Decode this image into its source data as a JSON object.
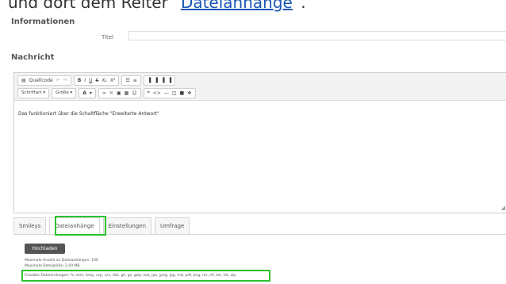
{
  "caption": {
    "prefix": "und dort dem Reiter “",
    "link": "Dateianhänge",
    "suffix": "”."
  },
  "sections": {
    "informationen": "Informationen",
    "nachricht": "Nachricht"
  },
  "titel": {
    "label": "Titel",
    "value": ""
  },
  "toolbar": {
    "row1": {
      "quellcode": "Quellcode",
      "undo": "↶",
      "redo": "↷",
      "bold": "B",
      "italic": "I",
      "underline": "U",
      "strike": "S",
      "subscript": "X₂",
      "superscript": "X²",
      "numbered_list": "☰",
      "bullet_list": "≡",
      "align_left": "▐",
      "align_center": "▐",
      "align_right": "▐",
      "align_justify": "▐"
    },
    "row2": {
      "schriftart": "Schriftart",
      "groesse": "Größe",
      "font_color": "A",
      "link": "∞",
      "unlink": "✖",
      "image": "▣",
      "table": "▦",
      "smiley": "☺",
      "quote": "❝",
      "code": "<>",
      "hr": "—",
      "media": "◫",
      "spoiler": "■",
      "other": "❖"
    }
  },
  "editor": {
    "content": "Das funktioniert über die Schaltfläche \"Erweiterte Antwort\""
  },
  "tabs": [
    {
      "label": "Smileys"
    },
    {
      "label": "Dateianhänge"
    },
    {
      "label": "Einstellungen"
    },
    {
      "label": "Umfrage"
    }
  ],
  "upload": {
    "button": "Hochladen",
    "max_count": "Maximale Anzahl an Dateianhängen: 100",
    "max_size": "Maximale Dateigröße: 2,00 MB",
    "extensions": "Erlaubte Dateiendungen: fs, sem, bmp, csp, csv, dat, gif, gs, gzip, bat, jpe, jpeg, jpg, md, pdf, png, rar, rtf, tar, txt, zip"
  },
  "colors": {
    "highlight": "#2ec22e",
    "link": "#1a57b5",
    "upload_button": "#555555"
  }
}
